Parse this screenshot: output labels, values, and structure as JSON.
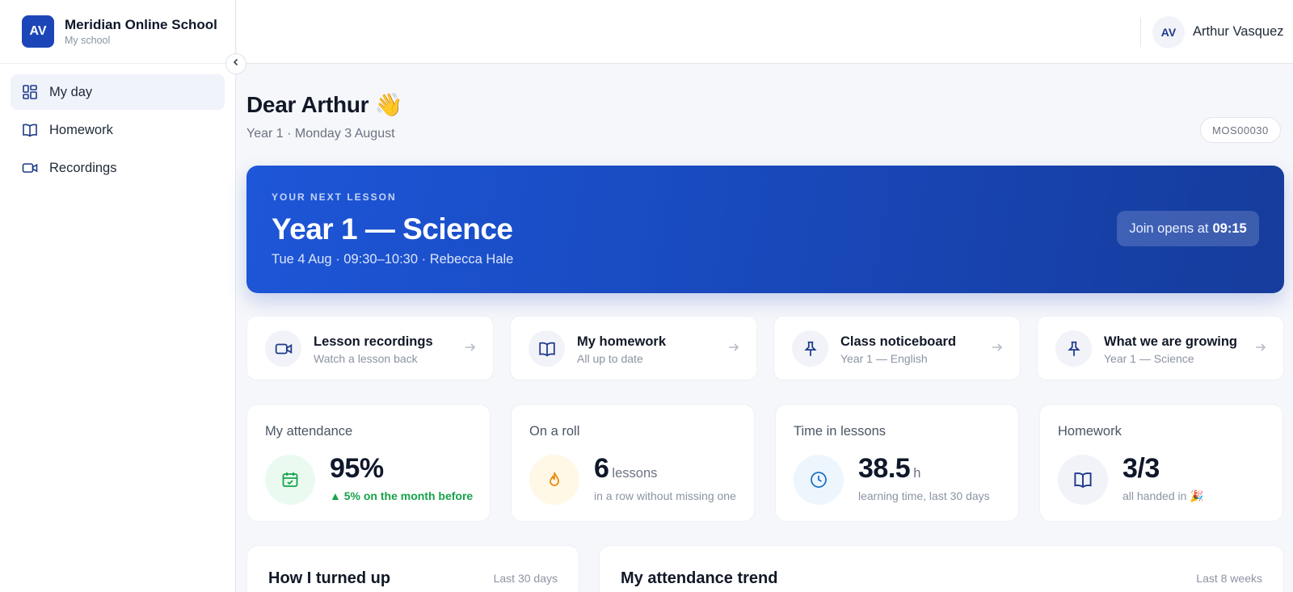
{
  "brand": {
    "initials": "AV",
    "name": "Meridian Online School",
    "subtitle": "My school"
  },
  "sidebar": {
    "items": [
      {
        "label": "My day",
        "icon": "dashboard-icon",
        "active": true
      },
      {
        "label": "Homework",
        "icon": "book-icon"
      },
      {
        "label": "Recordings",
        "icon": "video-icon"
      }
    ]
  },
  "user": {
    "initials": "AV",
    "name": "Arthur Vasquez"
  },
  "greeting": {
    "title": "Dear Arthur",
    "emoji": "👋",
    "subtitle": "Year 1 · Monday 3 August",
    "code": "MOS00030"
  },
  "next_lesson": {
    "kicker": "YOUR NEXT LESSON",
    "title": "Year 1 — Science",
    "meta": "Tue 4 Aug · 09:30–10:30 · Rebecca Hale",
    "join_prefix": "Join opens at",
    "join_time": "09:15"
  },
  "quick_links": [
    {
      "title": "Lesson recordings",
      "subtitle": "Watch a lesson back",
      "icon": "video-icon"
    },
    {
      "title": "My homework",
      "subtitle": "All up to date",
      "icon": "book-icon"
    },
    {
      "title": "Class noticeboard",
      "subtitle": "Year 1 — English",
      "icon": "pin-icon"
    },
    {
      "title": "What we are growing",
      "subtitle": "Year 1 — Science",
      "icon": "pin-icon"
    }
  ],
  "stats": [
    {
      "label": "My attendance",
      "value": "95%",
      "unit": "",
      "note": "▲ 5% on the month before",
      "icon": "calendar-check-icon"
    },
    {
      "label": "On a roll",
      "value": "6",
      "unit": "lessons",
      "note": "in a row without missing one",
      "icon": "flame-icon"
    },
    {
      "label": "Time in lessons",
      "value": "38.5",
      "unit": "h",
      "note": "learning time, last 30 days",
      "icon": "clock-icon"
    },
    {
      "label": "Homework",
      "value": "3/3",
      "unit": "",
      "note": "all handed in 🎉",
      "icon": "book-icon"
    }
  ],
  "panels": [
    {
      "title": "How I turned up",
      "range": "Last 30 days"
    },
    {
      "title": "My attendance trend",
      "range": "Last 8 weeks"
    }
  ],
  "colors": {
    "accent": "#1c46b8",
    "hero_start": "#1d56d8",
    "hero_end": "#163c9c",
    "positive": "#16a34a"
  }
}
